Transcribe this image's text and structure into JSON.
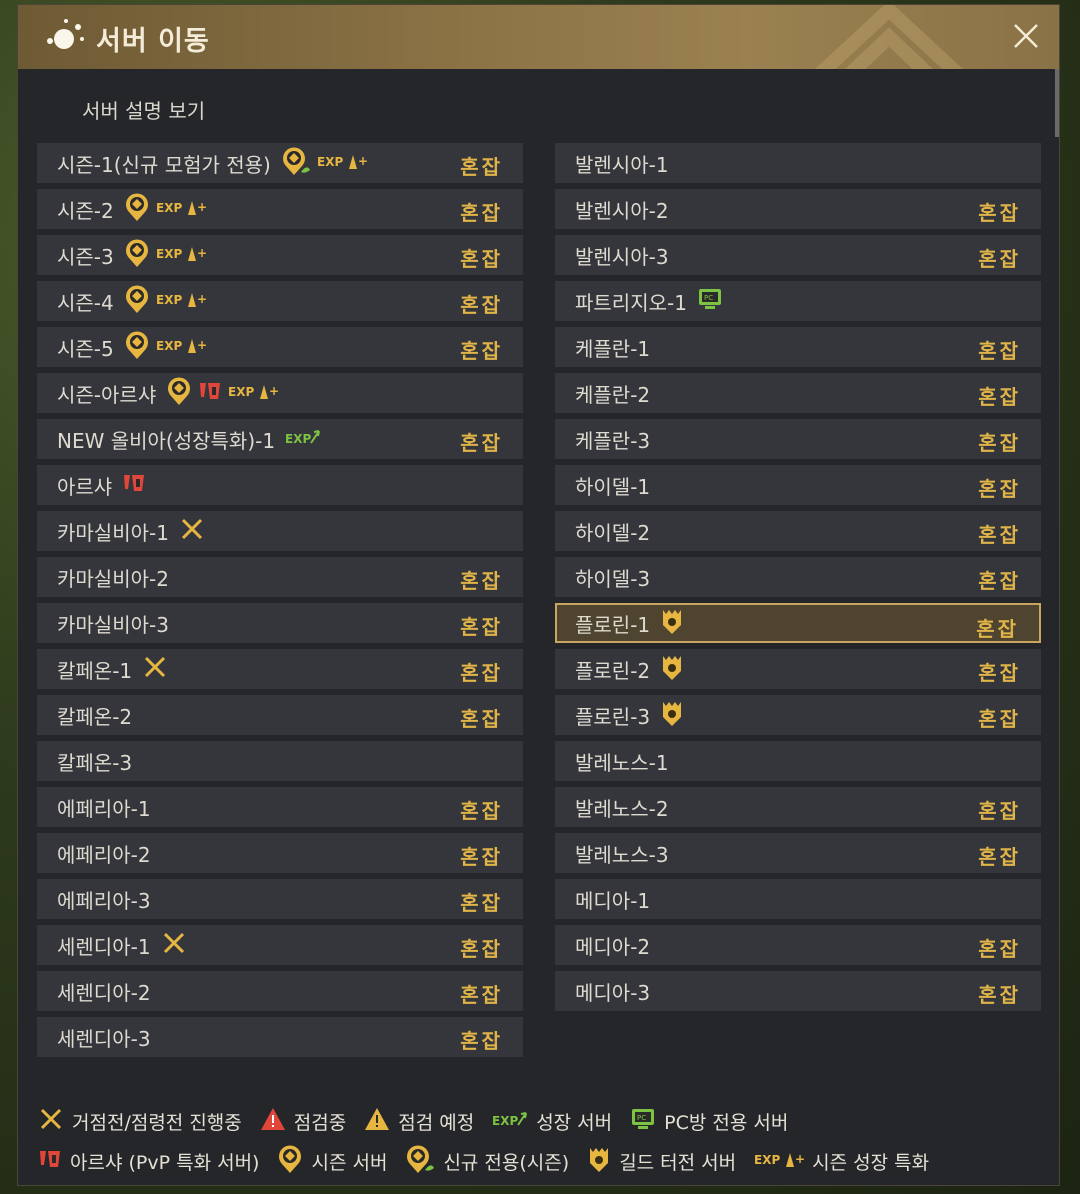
{
  "window": {
    "title": "서버 이동",
    "description_link": "서버 설명 보기"
  },
  "status_label": "혼잡",
  "left_servers": [
    {
      "name": "시즌-1(신규 모험가 전용)",
      "icons": [
        "season-newbie-icon",
        "season-growth-icon"
      ],
      "status": "혼잡"
    },
    {
      "name": "시즌-2",
      "icons": [
        "season-server-icon",
        "season-growth-icon"
      ],
      "status": "혼잡"
    },
    {
      "name": "시즌-3",
      "icons": [
        "season-server-icon",
        "season-growth-icon"
      ],
      "status": "혼잡"
    },
    {
      "name": "시즌-4",
      "icons": [
        "season-server-icon",
        "season-growth-icon"
      ],
      "status": "혼잡"
    },
    {
      "name": "시즌-5",
      "icons": [
        "season-server-icon",
        "season-growth-icon"
      ],
      "status": "혼잡"
    },
    {
      "name": "시즌-아르샤",
      "icons": [
        "season-server-icon",
        "arsha-pvp-icon",
        "season-growth-icon"
      ],
      "status": ""
    },
    {
      "name": "NEW 올비아(성장특화)-1",
      "icons": [
        "growth-server-icon"
      ],
      "status": "혼잡"
    },
    {
      "name": "아르샤",
      "icons": [
        "arsha-pvp-icon"
      ],
      "status": ""
    },
    {
      "name": "카마실비아-1",
      "icons": [
        "node-war-icon"
      ],
      "status": ""
    },
    {
      "name": "카마실비아-2",
      "icons": [],
      "status": "혼잡"
    },
    {
      "name": "카마실비아-3",
      "icons": [],
      "status": "혼잡"
    },
    {
      "name": "칼페온-1",
      "icons": [
        "node-war-icon"
      ],
      "status": "혼잡"
    },
    {
      "name": "칼페온-2",
      "icons": [],
      "status": "혼잡"
    },
    {
      "name": "칼페온-3",
      "icons": [],
      "status": ""
    },
    {
      "name": "에페리아-1",
      "icons": [],
      "status": "혼잡"
    },
    {
      "name": "에페리아-2",
      "icons": [],
      "status": "혼잡"
    },
    {
      "name": "에페리아-3",
      "icons": [],
      "status": "혼잡"
    },
    {
      "name": "세렌디아-1",
      "icons": [
        "node-war-icon"
      ],
      "status": "혼잡"
    },
    {
      "name": "세렌디아-2",
      "icons": [],
      "status": "혼잡"
    },
    {
      "name": "세렌디아-3",
      "icons": [],
      "status": "혼잡"
    }
  ],
  "right_servers": [
    {
      "name": "발렌시아-1",
      "icons": [],
      "status": ""
    },
    {
      "name": "발렌시아-2",
      "icons": [],
      "status": "혼잡"
    },
    {
      "name": "발렌시아-3",
      "icons": [],
      "status": "혼잡"
    },
    {
      "name": "파트리지오-1",
      "icons": [
        "pc-cafe-icon"
      ],
      "status": ""
    },
    {
      "name": "케플란-1",
      "icons": [],
      "status": "혼잡"
    },
    {
      "name": "케플란-2",
      "icons": [],
      "status": "혼잡"
    },
    {
      "name": "케플란-3",
      "icons": [],
      "status": "혼잡"
    },
    {
      "name": "하이델-1",
      "icons": [],
      "status": "혼잡"
    },
    {
      "name": "하이델-2",
      "icons": [],
      "status": "혼잡"
    },
    {
      "name": "하이델-3",
      "icons": [],
      "status": "혼잡"
    },
    {
      "name": "플로린-1",
      "icons": [
        "guild-territory-icon"
      ],
      "status": "혼잡",
      "selected": true
    },
    {
      "name": "플로린-2",
      "icons": [
        "guild-territory-icon"
      ],
      "status": "혼잡"
    },
    {
      "name": "플로린-3",
      "icons": [
        "guild-territory-icon"
      ],
      "status": "혼잡"
    },
    {
      "name": "발레노스-1",
      "icons": [],
      "status": ""
    },
    {
      "name": "발레노스-2",
      "icons": [],
      "status": "혼잡"
    },
    {
      "name": "발레노스-3",
      "icons": [],
      "status": "혼잡"
    },
    {
      "name": "메디아-1",
      "icons": [],
      "status": ""
    },
    {
      "name": "메디아-2",
      "icons": [],
      "status": "혼잡"
    },
    {
      "name": "메디아-3",
      "icons": [],
      "status": "혼잡"
    }
  ],
  "legend": {
    "row1": [
      {
        "icon": "node-war-icon",
        "label": "거점전/점령전 진행중"
      },
      {
        "icon": "maintenance-icon",
        "label": "점검중"
      },
      {
        "icon": "maintenance-scheduled-icon",
        "label": "점검 예정"
      },
      {
        "icon": "growth-server-icon",
        "label": "성장 서버"
      },
      {
        "icon": "pc-cafe-icon",
        "label": "PC방 전용 서버"
      }
    ],
    "row2": [
      {
        "icon": "arsha-pvp-icon",
        "label": "아르샤 (PvP 특화 서버)"
      },
      {
        "icon": "season-server-icon",
        "label": "시즌 서버"
      },
      {
        "icon": "season-newbie-icon",
        "label": "신규 전용(시즌)"
      },
      {
        "icon": "guild-territory-icon",
        "label": "길드 터전 서버"
      },
      {
        "icon": "season-growth-icon",
        "label": "시즌 성장 특화"
      }
    ]
  },
  "colors": {
    "accent": "#e0b448",
    "row_bg": "#34363b",
    "panel_bg": "#25262a",
    "selected_border": "#c9a660"
  }
}
